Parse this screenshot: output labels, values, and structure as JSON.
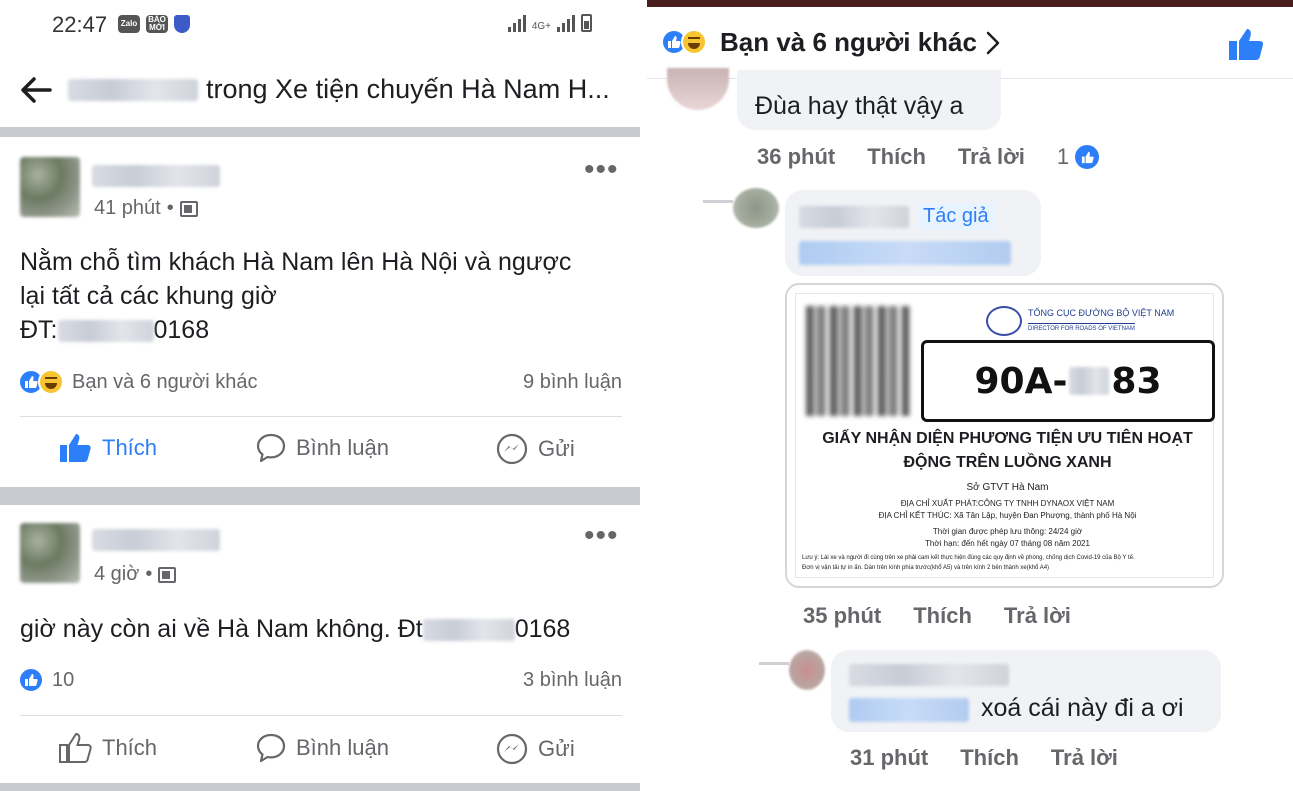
{
  "status": {
    "time": "22:47",
    "app1": "Zalo",
    "app2": "BÁO MỚI",
    "network": "4G+"
  },
  "left": {
    "header_title": "trong Xe tiện chuyến Hà Nam H...",
    "posts": [
      {
        "time": "41 phút",
        "text_line1": "Nằm chỗ tìm khách Hà Nam lên Hà Nội và ngược",
        "text_line2": "lại tất cả các khung giờ",
        "phone_prefix": "ĐT:",
        "phone_suffix": "0168",
        "reactions_text": "Bạn và 6 người khác",
        "comments": "9 bình luận"
      },
      {
        "time": "4 giờ",
        "text_prefix": "giờ này còn ai về Hà Nam không. Đt",
        "phone_suffix": "0168",
        "reactions_text": "10",
        "comments": "3 bình luận"
      }
    ],
    "actions": {
      "like": "Thích",
      "comment": "Bình luận",
      "send": "Gửi"
    }
  },
  "right": {
    "header_text": "Bạn và 6 người khác",
    "comments": [
      {
        "text": "Đùa hay thật vậy a",
        "time": "36 phút",
        "like": "Thích",
        "reply": "Trả lời",
        "like_count": "1"
      },
      {
        "badge": "Tác giả",
        "time": "35 phút",
        "like": "Thích",
        "reply": "Trả lời"
      },
      {
        "text": "xoá cái này đi a ơi",
        "time": "31 phút",
        "like": "Thích",
        "reply": "Trả lời"
      }
    ],
    "certificate": {
      "org": "TỔNG CỤC ĐƯỜNG BỘ VIỆT NAM",
      "org_sub": "DIRECTOR FOR ROADS OF VIETNAM",
      "plate_prefix": "90A-",
      "plate_suffix": "83",
      "title_line1": "GIẤY NHẬN DIỆN PHƯƠNG TIỆN ƯU TIÊN HOẠT",
      "title_line2": "ĐỘNG TRÊN LUỒNG XANH",
      "dept": "Sở GTVT Hà Nam",
      "from": "ĐỊA CHỈ XUẤT PHÁT:CÔNG TY TNHH DYNAOX VIỆT NAM",
      "to": "ĐỊA CHỈ KẾT THÚC: Xã Tân Lập, huyện Đan Phượng, thành phố Hà Nội",
      "time_allowed": "Thời gian được phép lưu thông: 24/24 giờ",
      "deadline": "Thời hạn: đến hết ngày 07 tháng 08 năm 2021",
      "note1": "Lưu ý: Lái xe và người đi cùng trên xe phải cam kết thực hiện đúng các quy định về phòng, chống dịch Covid-19 của Bộ Y tế.",
      "note2": "Đơn vị vận tải tự in ấn. Dán trên kính phía trước(khổ A5) và trên kính 2 bên thành xe(khổ A4)"
    }
  },
  "colors": {
    "fb_blue": "#2d7ff9",
    "text": "#1c1e21",
    "muted": "#65676b",
    "divider": "#c8ccd2"
  },
  "icons": [
    "back-arrow-icon",
    "globe-icon",
    "more-icon",
    "like-icon",
    "haha-icon",
    "comment-icon",
    "messenger-icon",
    "chevron-right-icon"
  ]
}
